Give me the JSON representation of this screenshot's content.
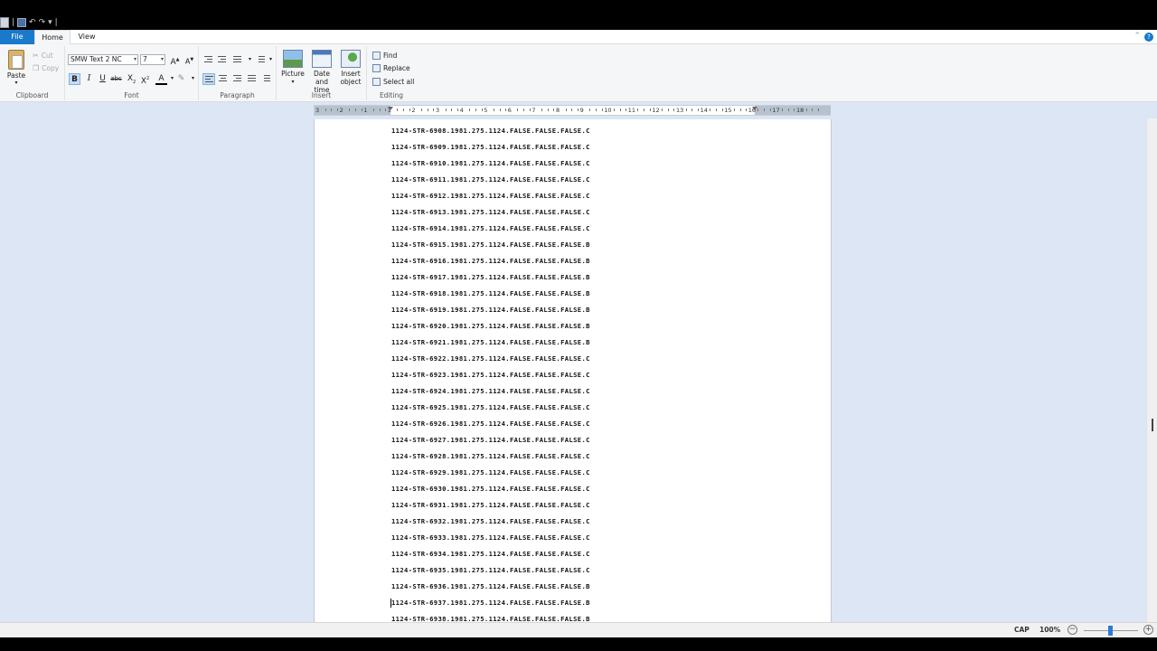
{
  "tabs": {
    "file": "File",
    "home": "Home",
    "view": "View"
  },
  "clipboard": {
    "group_label": "Clipboard",
    "paste": "Paste",
    "cut": "Cut",
    "copy": "Copy"
  },
  "font": {
    "group_label": "Font",
    "name": "SMW Text 2 NC",
    "size": "7"
  },
  "paragraph": {
    "group_label": "Paragraph"
  },
  "insert": {
    "group_label": "Insert",
    "picture": "Picture",
    "datetime_1": "Date and",
    "datetime_2": "time",
    "object_1": "Insert",
    "object_2": "object"
  },
  "editing": {
    "group_label": "Editing",
    "find": "Find",
    "replace": "Replace",
    "select_all": "Select all"
  },
  "ruler_numbers": [
    "3",
    "2",
    "1",
    "1",
    "2",
    "3",
    "4",
    "5",
    "6",
    "7",
    "8",
    "9",
    "10",
    "11",
    "12",
    "13",
    "14",
    "15",
    "16",
    "17",
    "18"
  ],
  "document_lines": [
    "1124-STR-6908.1981.275.1124.FALSE.FALSE.FALSE.C",
    "1124-STR-6909.1981.275.1124.FALSE.FALSE.FALSE.C",
    "1124-STR-6910.1981.275.1124.FALSE.FALSE.FALSE.C",
    "1124-STR-6911.1981.275.1124.FALSE.FALSE.FALSE.C",
    "1124-STR-6912.1981.275.1124.FALSE.FALSE.FALSE.C",
    "1124-STR-6913.1981.275.1124.FALSE.FALSE.FALSE.C",
    "1124-STR-6914.1981.275.1124.FALSE.FALSE.FALSE.C",
    "1124-STR-6915.1981.275.1124.FALSE.FALSE.FALSE.B",
    "1124-STR-6916.1981.275.1124.FALSE.FALSE.FALSE.B",
    "1124-STR-6917.1981.275.1124.FALSE.FALSE.FALSE.B",
    "1124-STR-6918.1981.275.1124.FALSE.FALSE.FALSE.B",
    "1124-STR-6919.1981.275.1124.FALSE.FALSE.FALSE.B",
    "1124-STR-6920.1981.275.1124.FALSE.FALSE.FALSE.B",
    "1124-STR-6921.1981.275.1124.FALSE.FALSE.FALSE.B",
    "1124-STR-6922.1981.275.1124.FALSE.FALSE.FALSE.C",
    "1124-STR-6923.1981.275.1124.FALSE.FALSE.FALSE.C",
    "1124-STR-6924.1981.275.1124.FALSE.FALSE.FALSE.C",
    "1124-STR-6925.1981.275.1124.FALSE.FALSE.FALSE.C",
    "1124-STR-6926.1981.275.1124.FALSE.FALSE.FALSE.C",
    "1124-STR-6927.1981.275.1124.FALSE.FALSE.FALSE.C",
    "1124-STR-6928.1981.275.1124.FALSE.FALSE.FALSE.C",
    "1124-STR-6929.1981.275.1124.FALSE.FALSE.FALSE.C",
    "1124-STR-6930.1981.275.1124.FALSE.FALSE.FALSE.C",
    "1124-STR-6931.1981.275.1124.FALSE.FALSE.FALSE.C",
    "1124-STR-6932.1981.275.1124.FALSE.FALSE.FALSE.C",
    "1124-STR-6933.1981.275.1124.FALSE.FALSE.FALSE.C",
    "1124-STR-6934.1981.275.1124.FALSE.FALSE.FALSE.C",
    "1124-STR-6935.1981.275.1124.FALSE.FALSE.FALSE.C",
    "1124-STR-6936.1981.275.1124.FALSE.FALSE.FALSE.B",
    "1124-STR-6937.1981.275.1124.FALSE.FALSE.FALSE.B",
    "1124-STR-6938.1981.275.1124.FALSE.FALSE.FALSE.B"
  ],
  "caret_line": 29,
  "status": {
    "caps": "CAP",
    "zoom": "100%"
  },
  "colors": {
    "accent": "#1979ca",
    "workspace": "#dce6f4",
    "active_button": "#c5dcf3"
  }
}
